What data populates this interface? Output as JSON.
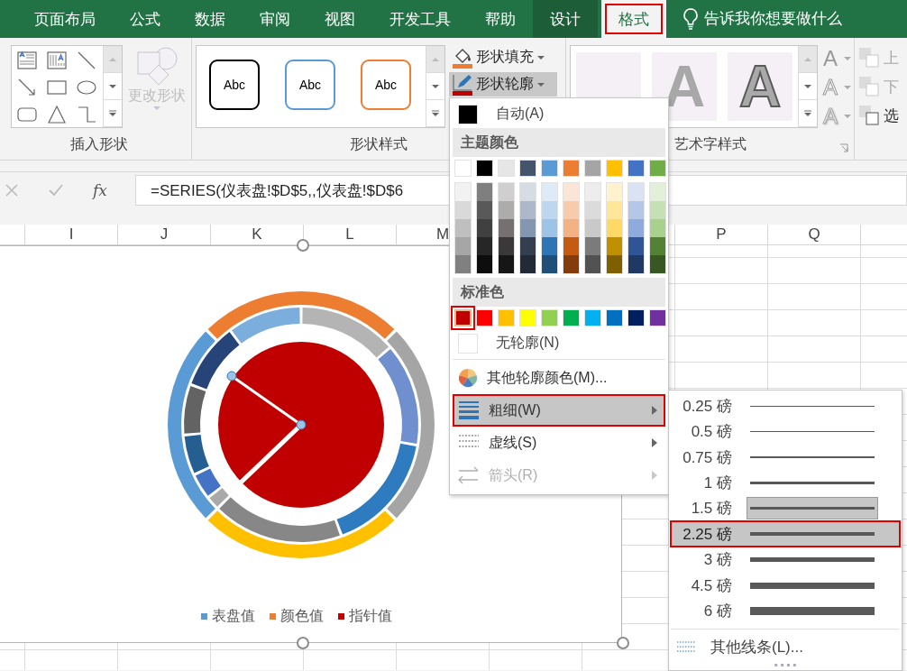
{
  "ribbon_tabs": [
    {
      "label": "页面布局",
      "contextual": false,
      "selected": false
    },
    {
      "label": "公式",
      "contextual": false,
      "selected": false
    },
    {
      "label": "数据",
      "contextual": false,
      "selected": false
    },
    {
      "label": "审阅",
      "contextual": false,
      "selected": false
    },
    {
      "label": "视图",
      "contextual": false,
      "selected": false
    },
    {
      "label": "开发工具",
      "contextual": false,
      "selected": false
    },
    {
      "label": "帮助",
      "contextual": false,
      "selected": false
    },
    {
      "label": "设计",
      "contextual": true,
      "selected": false
    },
    {
      "label": "格式",
      "contextual": true,
      "selected": true
    }
  ],
  "tell_me": {
    "placeholder": "告诉我你想要做什么"
  },
  "insert_shapes": {
    "label": "插入形状",
    "change_shape": {
      "label": "更改形状",
      "disabled": true
    }
  },
  "shape_styles": {
    "label": "形状样式",
    "presets": [
      {
        "text": "Abc",
        "color": "#000000"
      },
      {
        "text": "Abc",
        "color": "#5b9bd5"
      },
      {
        "text": "Abc",
        "color": "#ed7d31"
      }
    ],
    "fill_button": {
      "label": "形状填充"
    },
    "outline_button": {
      "label": "形状轮廓",
      "pressed": true
    }
  },
  "wordart_styles": {
    "label": "艺术字样式",
    "presets": [
      {
        "kind": "shadow"
      },
      {
        "text": "A",
        "kind": "soft"
      },
      {
        "text": "A",
        "kind": "outline"
      }
    ],
    "text_tools": [
      {
        "text": "A",
        "kind": "fill"
      },
      {
        "text": "A",
        "kind": "outline"
      },
      {
        "text": "A",
        "kind": "effects"
      }
    ]
  },
  "arrange": {
    "items": [
      {
        "label": "上",
        "disabled": true
      },
      {
        "label": "下",
        "disabled": true
      },
      {
        "label": "选",
        "disabled": false
      }
    ]
  },
  "formula_bar": {
    "function_label": "fx",
    "formula": "=SERIES(仪表盘!$D$5,,仪表盘!$D$6"
  },
  "columns_left": [
    "I",
    "J",
    "K",
    "L",
    "M"
  ],
  "columns_right": [
    "P",
    "Q"
  ],
  "chart": {
    "legend": [
      {
        "label": "表盘值",
        "color": "#5b9bd5"
      },
      {
        "label": "颜色值",
        "color": "#ed7d31"
      },
      {
        "label": "指针值",
        "color": "#c00000"
      }
    ]
  },
  "outline_menu": {
    "auto": "自动(A)",
    "theme_heading": "主题颜色",
    "theme_colors": [
      {
        "color": "#ffffff",
        "selected": false,
        "shades": [
          {
            "color": "#f2f2f2",
            "selected": false
          },
          {
            "color": "#d9d9d9",
            "selected": false
          },
          {
            "color": "#bfbfbf",
            "selected": false
          },
          {
            "color": "#a6a6a6",
            "selected": false
          },
          {
            "color": "#808080",
            "selected": false
          }
        ]
      },
      {
        "color": "#000000",
        "selected": false,
        "shades": [
          {
            "color": "#7f7f7f",
            "selected": false
          },
          {
            "color": "#595959",
            "selected": false
          },
          {
            "color": "#404040",
            "selected": false
          },
          {
            "color": "#262626",
            "selected": false
          },
          {
            "color": "#0d0d0d",
            "selected": false
          }
        ]
      },
      {
        "color": "#e7e6e6",
        "selected": false,
        "shades": [
          {
            "color": "#d0cece",
            "selected": false
          },
          {
            "color": "#aeabab",
            "selected": false
          },
          {
            "color": "#757171",
            "selected": false
          },
          {
            "color": "#3a3838",
            "selected": false
          },
          {
            "color": "#171616",
            "selected": false
          }
        ]
      },
      {
        "color": "#44546a",
        "selected": false,
        "shades": [
          {
            "color": "#d6dce4",
            "selected": false
          },
          {
            "color": "#adb9ca",
            "selected": false
          },
          {
            "color": "#8497b0",
            "selected": false
          },
          {
            "color": "#333f4f",
            "selected": false
          },
          {
            "color": "#222a35",
            "selected": false
          }
        ]
      },
      {
        "color": "#5b9bd5",
        "selected": false,
        "shades": [
          {
            "color": "#deebf7",
            "selected": false
          },
          {
            "color": "#bdd7ee",
            "selected": false
          },
          {
            "color": "#9dc3e6",
            "selected": false
          },
          {
            "color": "#2e75b6",
            "selected": false
          },
          {
            "color": "#1f4e79",
            "selected": false
          }
        ]
      },
      {
        "color": "#ed7d31",
        "selected": false,
        "shades": [
          {
            "color": "#fbe5d6",
            "selected": false
          },
          {
            "color": "#f8cbad",
            "selected": false
          },
          {
            "color": "#f4b183",
            "selected": false
          },
          {
            "color": "#c55a11",
            "selected": false
          },
          {
            "color": "#843c0c",
            "selected": false
          }
        ]
      },
      {
        "color": "#a5a5a5",
        "selected": false,
        "shades": [
          {
            "color": "#ededed",
            "selected": false
          },
          {
            "color": "#dbdbdb",
            "selected": false
          },
          {
            "color": "#c9c9c9",
            "selected": false
          },
          {
            "color": "#7b7b7b",
            "selected": false
          },
          {
            "color": "#525252",
            "selected": false
          }
        ]
      },
      {
        "color": "#ffc000",
        "selected": false,
        "shades": [
          {
            "color": "#fff2cc",
            "selected": false
          },
          {
            "color": "#ffe699",
            "selected": false
          },
          {
            "color": "#ffd966",
            "selected": false
          },
          {
            "color": "#bf9000",
            "selected": false
          },
          {
            "color": "#7f6000",
            "selected": false
          }
        ]
      },
      {
        "color": "#4472c4",
        "selected": false,
        "shades": [
          {
            "color": "#dae3f3",
            "selected": false
          },
          {
            "color": "#b4c7e7",
            "selected": false
          },
          {
            "color": "#8faadc",
            "selected": false
          },
          {
            "color": "#2f5597",
            "selected": false
          },
          {
            "color": "#203864",
            "selected": false
          }
        ]
      },
      {
        "color": "#70ad47",
        "selected": false,
        "shades": [
          {
            "color": "#e2f0d9",
            "selected": false
          },
          {
            "color": "#c5e0b4",
            "selected": false
          },
          {
            "color": "#a9d18e",
            "selected": false
          },
          {
            "color": "#548235",
            "selected": false
          },
          {
            "color": "#385723",
            "selected": false
          }
        ]
      }
    ],
    "standard_heading": "标准色",
    "standard_colors": [
      {
        "color": "#c00000",
        "selected": true
      },
      {
        "color": "#ff0000",
        "selected": false
      },
      {
        "color": "#ffc000",
        "selected": false
      },
      {
        "color": "#ffff00",
        "selected": false
      },
      {
        "color": "#92d050",
        "selected": false
      },
      {
        "color": "#00b050",
        "selected": false
      },
      {
        "color": "#00b0f0",
        "selected": false
      },
      {
        "color": "#0070c0",
        "selected": false
      },
      {
        "color": "#002060",
        "selected": false
      },
      {
        "color": "#7030a0",
        "selected": false
      }
    ],
    "no_outline": "无轮廓(N)",
    "more_colors": "其他轮廓颜色(M)...",
    "items": [
      {
        "label": "粗细(W)",
        "kind": "weight",
        "selected": true,
        "disabled": false
      },
      {
        "label": "虚线(S)",
        "kind": "dash",
        "selected": false,
        "disabled": false
      },
      {
        "label": "箭头(R)",
        "kind": "arrow",
        "selected": false,
        "disabled": true
      }
    ]
  },
  "weight_menu": {
    "items": [
      {
        "label": "0.25 磅",
        "kind": "w025",
        "selected": false,
        "current": false
      },
      {
        "label": "0.5 磅",
        "kind": "w05",
        "selected": false,
        "current": false
      },
      {
        "label": "0.75 磅",
        "kind": "w075",
        "selected": false,
        "current": false
      },
      {
        "label": "1 磅",
        "kind": "w1",
        "selected": false,
        "current": false
      },
      {
        "label": "1.5 磅",
        "kind": "w15",
        "selected": false,
        "current": true
      },
      {
        "label": "2.25 磅",
        "kind": "w225",
        "selected": true,
        "current": false
      },
      {
        "label": "3 磅",
        "kind": "w3",
        "selected": false,
        "current": false
      },
      {
        "label": "4.5 磅",
        "kind": "w45",
        "selected": false,
        "current": false
      },
      {
        "label": "6 磅",
        "kind": "w6",
        "selected": false,
        "current": false
      }
    ],
    "more_lines": "其他线条(L)..."
  }
}
